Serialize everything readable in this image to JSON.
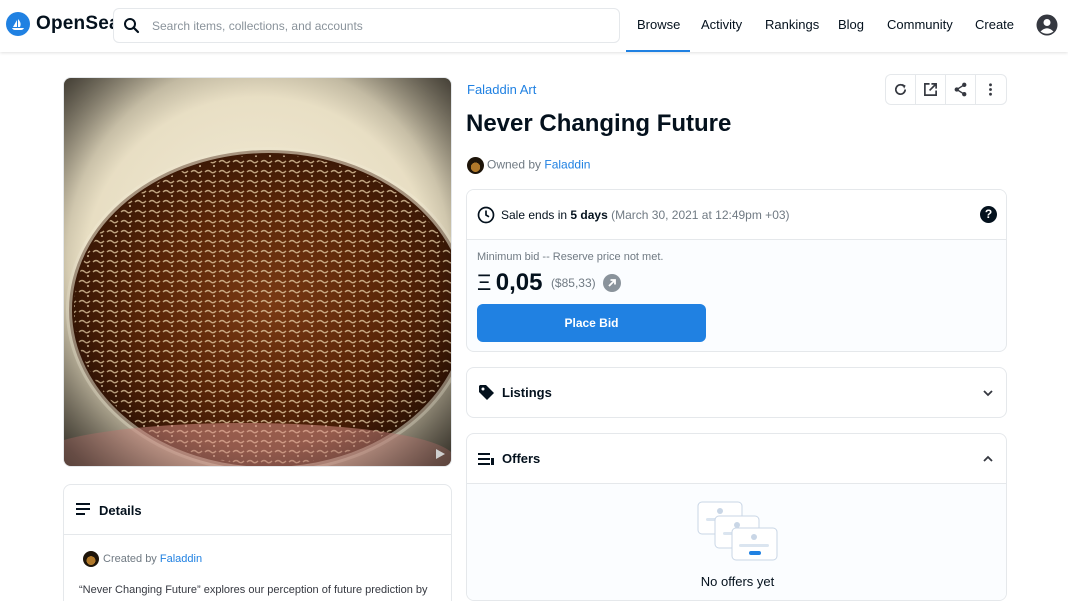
{
  "header": {
    "brand": "OpenSea",
    "search_placeholder": "Search items, collections, and accounts",
    "nav": [
      {
        "label": "Browse",
        "active": true
      },
      {
        "label": "Activity"
      },
      {
        "label": "Rankings"
      },
      {
        "label": "Blog"
      },
      {
        "label": "Community"
      },
      {
        "label": "Create"
      }
    ],
    "accent_color": "#2081e2"
  },
  "item": {
    "collection": "Faladdin Art",
    "title": "Never Changing Future",
    "owned_prefix": "Owned by",
    "owner": "Faladdin"
  },
  "actions": [
    "refresh-icon",
    "external-link-icon",
    "share-icon",
    "more-vert-icon"
  ],
  "trade": {
    "sale_prefix": "Sale ends in",
    "sale_duration": "5 days",
    "sale_date": "(March 30, 2021 at 12:49pm +03)",
    "min_bid_label": "Minimum bid -- Reserve price not met.",
    "eth_symbol": "Ξ",
    "price": "0,05",
    "usd": "($85,33)",
    "button": "Place Bid"
  },
  "listings": {
    "label": "Listings"
  },
  "offers": {
    "label": "Offers",
    "empty": "No offers yet"
  },
  "details": {
    "label": "Details",
    "created_prefix": "Created by",
    "creator": "Faladdin",
    "description": "“Never Changing Future” explores our perception of future prediction by"
  }
}
